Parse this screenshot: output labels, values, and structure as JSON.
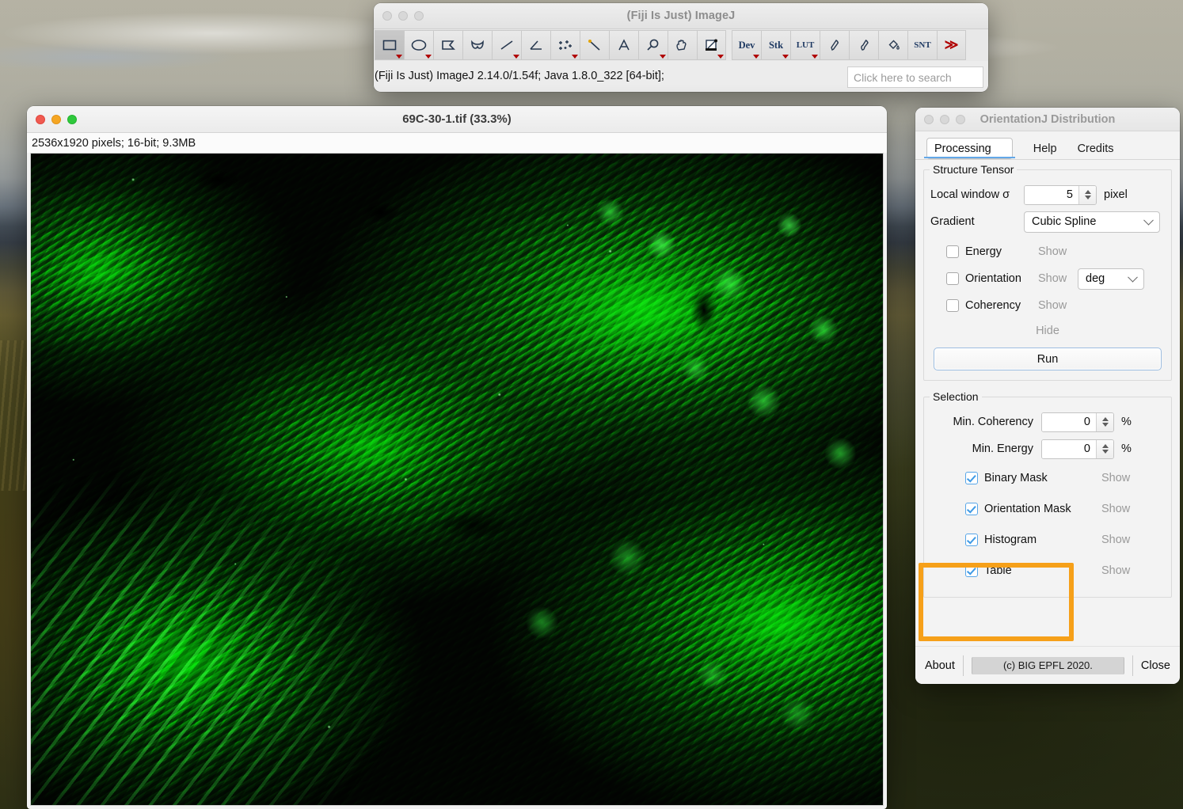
{
  "fiji": {
    "window_title": "(Fiji Is Just) ImageJ",
    "status": "(Fiji Is Just) ImageJ 2.14.0/1.54f; Java 1.8.0_322 [64-bit];",
    "search_placeholder": "Click here to search",
    "search_value": "",
    "tools": [
      {
        "name": "rectangle-tool",
        "glyph": "rect",
        "dropdown": true,
        "active": true
      },
      {
        "name": "oval-tool",
        "glyph": "oval",
        "dropdown": true,
        "active": false
      },
      {
        "name": "polygon-tool",
        "glyph": "polygon",
        "dropdown": false,
        "active": false
      },
      {
        "name": "freehand-tool",
        "glyph": "freehand",
        "dropdown": false,
        "active": false
      },
      {
        "name": "line-tool",
        "glyph": "line",
        "dropdown": true,
        "active": false
      },
      {
        "name": "angle-tool",
        "glyph": "angle",
        "dropdown": false,
        "active": false
      },
      {
        "name": "multipoint-tool",
        "glyph": "points",
        "dropdown": true,
        "active": false
      },
      {
        "name": "wand-tool",
        "glyph": "wand",
        "dropdown": false,
        "active": false
      },
      {
        "name": "text-tool",
        "glyph": "text",
        "dropdown": false,
        "active": false
      },
      {
        "name": "magnifier-tool",
        "glyph": "magnifier",
        "dropdown": true,
        "active": false
      },
      {
        "name": "hand-tool",
        "glyph": "hand",
        "dropdown": false,
        "active": false
      },
      {
        "name": "dropper-tool",
        "glyph": "dropper",
        "dropdown": true,
        "active": false
      }
    ],
    "plugin_buttons": [
      {
        "name": "dev-button",
        "label": "Dev",
        "dropdown": true
      },
      {
        "name": "stk-button",
        "label": "Stk",
        "dropdown": true
      },
      {
        "name": "lut-button",
        "label": "LUT",
        "dropdown": true
      },
      {
        "name": "pencil-button",
        "label": "",
        "glyph": "pencil",
        "dropdown": false
      },
      {
        "name": "brush-button",
        "label": "",
        "glyph": "brush",
        "dropdown": false
      },
      {
        "name": "fill-button",
        "label": "",
        "glyph": "bucket",
        "dropdown": false
      },
      {
        "name": "snt-button",
        "label": "SNT",
        "dropdown": false
      },
      {
        "name": "more-tools-button",
        "label": "≫",
        "dropdown": false
      }
    ]
  },
  "image_window": {
    "title": "69C-30-1.tif (33.3%)",
    "info": "2536x1920 pixels; 16-bit; 9.3MB",
    "dimensions_px": "2536x1920",
    "bit_depth": "16-bit",
    "file_size": "9.3MB",
    "zoom": "33.3%"
  },
  "orientationj": {
    "window_title": "OrientationJ Distribution",
    "tabs": [
      {
        "label": "Processing",
        "selected": true
      },
      {
        "label": "Help",
        "selected": false
      },
      {
        "label": "Credits",
        "selected": false
      }
    ],
    "structure_tensor": {
      "legend": "Structure Tensor",
      "local_window_label": "Local window σ",
      "local_window_value": "5",
      "local_window_unit": "pixel",
      "gradient_label": "Gradient",
      "gradient_value": "Cubic Spline",
      "checkboxes": [
        {
          "label": "Energy",
          "checked": false,
          "action": "Show",
          "unit": null
        },
        {
          "label": "Orientation",
          "checked": false,
          "action": "Show",
          "unit": "deg"
        },
        {
          "label": "Coherency",
          "checked": false,
          "action": "Show",
          "unit": null
        }
      ],
      "hide_label": "Hide",
      "run_label": "Run"
    },
    "selection": {
      "legend": "Selection",
      "min_coherency_label": "Min. Coherency",
      "min_coherency_value": "0",
      "min_coherency_unit": "%",
      "min_energy_label": "Min. Energy",
      "min_energy_value": "0",
      "min_energy_unit": "%",
      "outputs": [
        {
          "label": "Binary Mask",
          "checked": true,
          "action": "Show",
          "highlighted": false
        },
        {
          "label": "Orientation Mask",
          "checked": true,
          "action": "Show",
          "highlighted": false
        },
        {
          "label": "Histogram",
          "checked": true,
          "action": "Show",
          "highlighted": true
        },
        {
          "label": "Table",
          "checked": true,
          "action": "Show",
          "highlighted": true
        }
      ]
    },
    "footer": {
      "about_label": "About",
      "copyright": "(c) BIG EPFL 2020.",
      "close_label": "Close"
    }
  },
  "colors": {
    "highlight_orange": "#F6A019",
    "checkbox_blue": "#58A6E8",
    "tab_underline": "#62A7E8",
    "fluorescence_green": "#00E100"
  }
}
